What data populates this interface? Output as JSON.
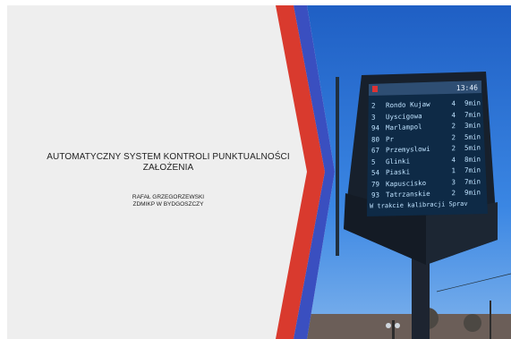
{
  "slide": {
    "title": "AUTOMATYCZNY SYSTEM KONTROLI PUNKTUALNOŚCI",
    "subtitle": "ZAŁOŻENIA",
    "author": "RAFAŁ GRZEGORZEWSKI",
    "organization": "ZDMIKP W BYDGOSZCZY"
  },
  "display": {
    "clock": "13:46",
    "rows": [
      {
        "line": "2",
        "dest": "Rondo Kujaw",
        "min": "4",
        "unit": "9min"
      },
      {
        "line": "3",
        "dest": "Uyscigowa",
        "min": "4",
        "unit": "7min"
      },
      {
        "line": "94",
        "dest": "Marlampol",
        "min": "2",
        "unit": "3min"
      },
      {
        "line": "80",
        "dest": "Pr",
        "min": "2",
        "unit": "5min"
      },
      {
        "line": "67",
        "dest": "Przemyslowi",
        "min": "2",
        "unit": "5min"
      },
      {
        "line": "5",
        "dest": "Glinki",
        "min": "4",
        "unit": "8min"
      },
      {
        "line": "54",
        "dest": "Piaski",
        "min": "1",
        "unit": "7min"
      },
      {
        "line": "79",
        "dest": "Kapuscisko",
        "min": "3",
        "unit": "7min"
      },
      {
        "line": "93",
        "dest": "Tatrzanskie",
        "min": "2",
        "unit": "9min"
      }
    ],
    "ticker": "W trakcie kalibracji Sprav"
  },
  "colors": {
    "background": "#eeeeee",
    "stripe_red": "#d93a2e",
    "stripe_blue": "#3a4fc0",
    "sky": "#2f73d6",
    "display_text": "#bfe3ff"
  }
}
